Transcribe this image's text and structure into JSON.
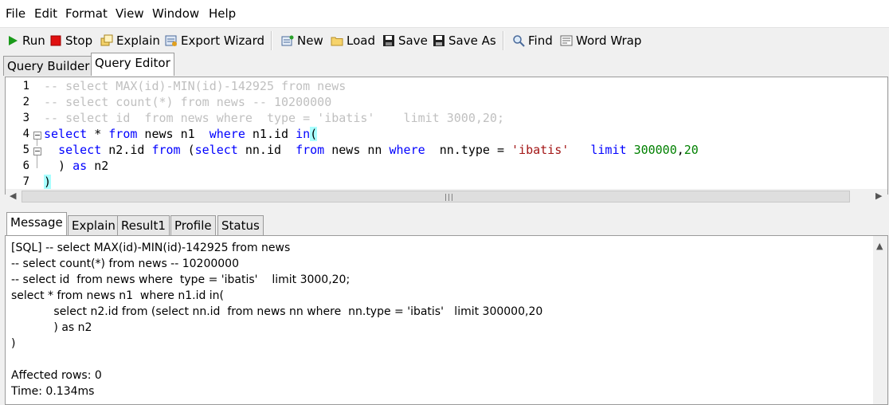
{
  "menu": {
    "items": [
      "File",
      "Edit",
      "Format",
      "View",
      "Window",
      "Help"
    ]
  },
  "toolbar": {
    "run": "Run",
    "stop": "Stop",
    "explain": "Explain",
    "export_wizard": "Export Wizard",
    "new": "New",
    "load": "Load",
    "save": "Save",
    "save_as": "Save As",
    "find": "Find",
    "word_wrap": "Word Wrap"
  },
  "top_tabs": [
    "Query Builder",
    "Query Editor"
  ],
  "editor": {
    "line_numbers": [
      "1",
      "2",
      "3",
      "4",
      "5",
      "6",
      "7"
    ],
    "lines": [
      "-- select MAX(id)-MIN(id)-142925 from news",
      "-- select count(*) from news -- 10200000",
      "-- select id  from news where  type = 'ibatis'    limit 3000,20;",
      "select * from news n1  where n1.id in(",
      "  select n2.id from (select nn.id  from news nn where  nn.type = 'ibatis'   limit 300000,20",
      "  ) as n2",
      ")"
    ]
  },
  "bottom_tabs": [
    "Message",
    "Explain",
    "Result1",
    "Profile",
    "Status"
  ],
  "message": {
    "lines": [
      "[SQL] -- select MAX(id)-MIN(id)-142925 from news",
      "-- select count(*) from news -- 10200000",
      "-- select id  from news where  type = 'ibatis'    limit 3000,20;",
      "select * from news n1  where n1.id in(",
      "            select n2.id from (select nn.id  from news nn where  nn.type = 'ibatis'   limit 300000,20",
      "            ) as n2",
      ")",
      "",
      "Affected rows: 0",
      "Time: 0.134ms"
    ]
  }
}
